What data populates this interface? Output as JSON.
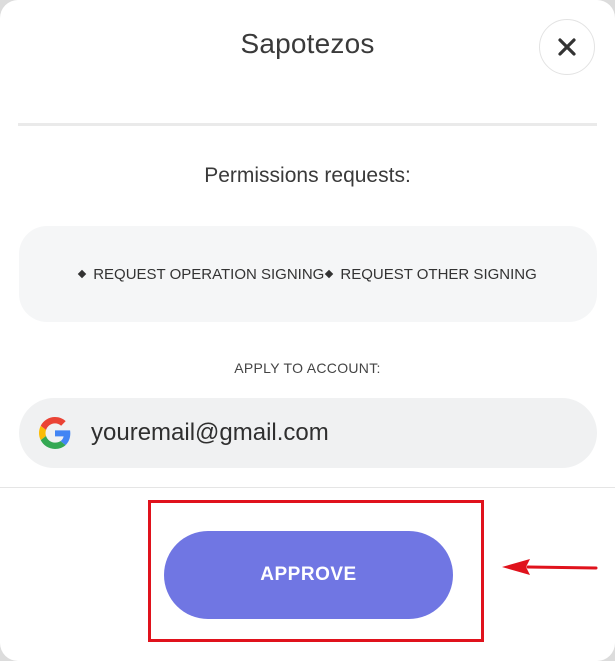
{
  "modal": {
    "title": "Sapotezos",
    "close_icon": "close-icon"
  },
  "permissions": {
    "heading": "Permissions requests:",
    "items": [
      "REQUEST OPERATION SIGNING",
      "REQUEST OTHER SIGNING"
    ]
  },
  "account": {
    "label": "APPLY TO ACCOUNT:",
    "provider_icon": "google-icon",
    "email": "youremail@gmail.com"
  },
  "actions": {
    "approve_label": "APPROVE"
  },
  "annotation": {
    "highlight_color": "#e0121c",
    "arrow_icon": "arrow-left-icon"
  },
  "colors": {
    "approve_bg": "#7076e3",
    "google_blue": "#4285F4",
    "google_red": "#EA4335",
    "google_yellow": "#FBBC05",
    "google_green": "#34A853"
  }
}
